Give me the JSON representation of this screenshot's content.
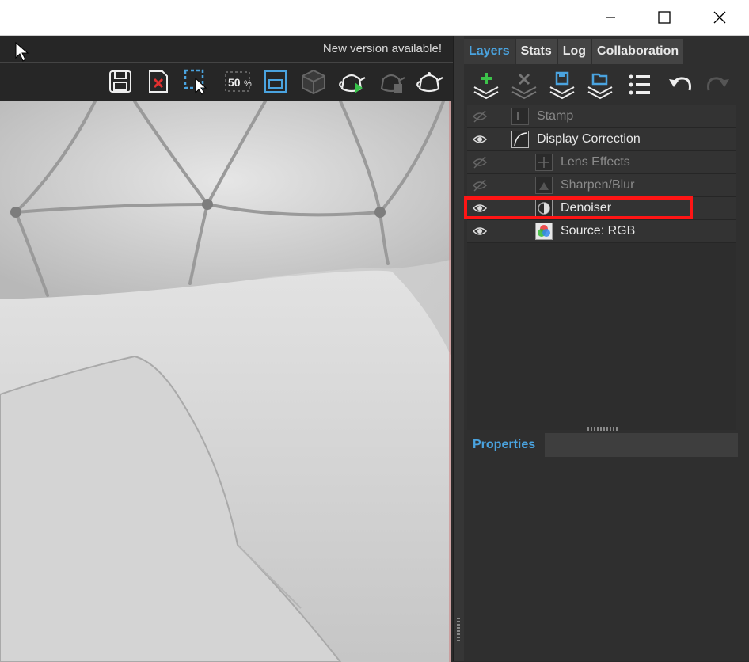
{
  "window": {
    "buttons": [
      "minimize-icon",
      "maximize-icon",
      "close-icon"
    ]
  },
  "notice": {
    "text": "New version available!"
  },
  "toolbar": {
    "icons": [
      "save-icon",
      "delete-icon",
      "region-select-icon",
      "zoom-50-icon",
      "fit-view-icon",
      "cube-icon",
      "render-teapot-icon",
      "stop-teapot-icon",
      "teapot-icon"
    ],
    "zoom_label": "50"
  },
  "panel": {
    "tabs": [
      "Layers",
      "Stats",
      "Log",
      "Collaboration"
    ],
    "active_tab": "Layers",
    "tools": [
      "add-layer-icon",
      "remove-layer-icon",
      "save-layer-icon",
      "load-layer-icon",
      "list-icon",
      "undo-icon",
      "redo-icon"
    ]
  },
  "layers": [
    {
      "label": "Stamp",
      "visible": false,
      "icon": "stamp-icon",
      "indent": 0
    },
    {
      "label": "Display Correction",
      "visible": true,
      "icon": "curve-icon",
      "indent": 0
    },
    {
      "label": "Lens Effects",
      "visible": false,
      "icon": "lens-effects-icon",
      "indent": 1
    },
    {
      "label": "Sharpen/Blur",
      "visible": false,
      "icon": "sharpen-icon",
      "indent": 1
    },
    {
      "label": "Denoiser",
      "visible": true,
      "icon": "denoiser-icon",
      "indent": 1,
      "highlighted": true
    },
    {
      "label": "Source: RGB",
      "visible": true,
      "icon": "rgb-icon",
      "indent": 1
    }
  ],
  "properties": {
    "label": "Properties"
  },
  "colors": {
    "accent": "#4aa3df",
    "highlight": "#ff1515"
  }
}
